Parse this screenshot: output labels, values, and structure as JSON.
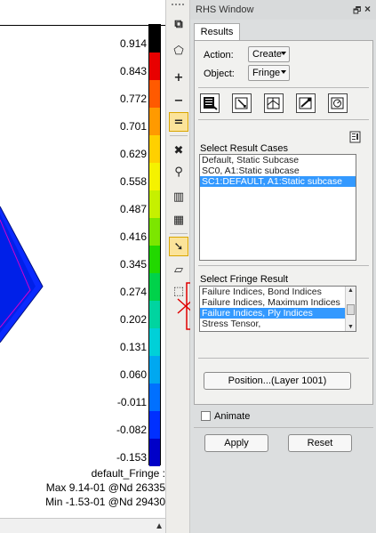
{
  "legend": {
    "values": [
      "0.914",
      "0.843",
      "0.772",
      "0.701",
      "0.629",
      "0.558",
      "0.487",
      "0.416",
      "0.345",
      "0.274",
      "0.202",
      "0.131",
      "0.060",
      "-0.011",
      "-0.082",
      "-0.153"
    ],
    "colors": [
      "#000000",
      "#e80000",
      "#ff5a00",
      "#ff9a00",
      "#ffd000",
      "#f5f200",
      "#c6f000",
      "#7ce600",
      "#22d800",
      "#00d24a",
      "#00d4a0",
      "#00d0d8",
      "#00a8f0",
      "#0070ff",
      "#0030ff",
      "#0000c8"
    ],
    "footer_title": "default_Fringe :",
    "footer_max": "Max 9.14-01 @Nd 26335",
    "footer_min": "Min -1.53-01 @Nd 29430"
  },
  "toolbar": {
    "buttons": [
      "copy-icon",
      "lasso-icon",
      "plus-icon",
      "minus-icon",
      "equals-icon",
      "cross-arrows-icon",
      "pick-icon",
      "grid-split-icon",
      "grid-merge-icon",
      "pointer-icon",
      "polygon-icon",
      "box-select-icon"
    ]
  },
  "panel": {
    "title": "RHS Window",
    "tab": "Results",
    "action_label": "Action:",
    "action_value": "Create",
    "object_label": "Object:",
    "object_value": "Fringe",
    "result_cases_label": "Select Result Cases",
    "result_cases": [
      "Default, Static Subcase",
      "SC0, A1:Static subcase",
      "SC1:DEFAULT, A1:Static subcase"
    ],
    "result_cases_selected": 2,
    "fringe_result_label": "Select Fringe Result",
    "fringe_results": [
      "Failure Indices, Bond Indices",
      "Failure Indices, Maximum Indices",
      "Failure Indices, Ply Indices",
      "Stress Tensor,"
    ],
    "fringe_results_selected": 2,
    "position_button": "Position...(Layer 1001)",
    "animate_label": "Animate",
    "apply_button": "Apply",
    "reset_button": "Reset"
  }
}
